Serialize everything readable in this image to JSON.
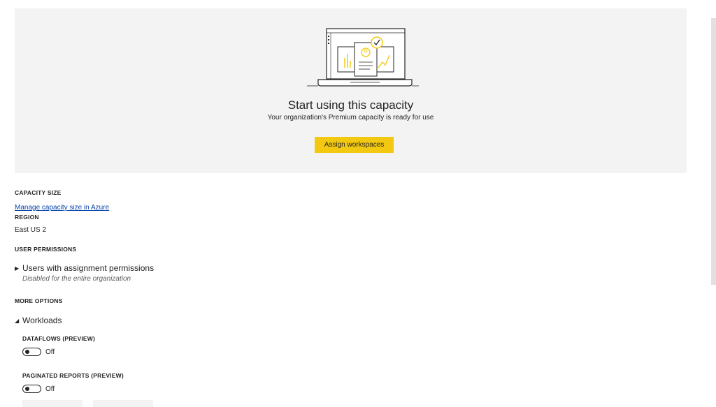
{
  "hero": {
    "title": "Start using this capacity",
    "subtitle": "Your organization's Premium capacity is ready for use",
    "assign_button": "Assign workspaces"
  },
  "capacity_size": {
    "heading": "CAPACITY SIZE",
    "link": "Manage capacity size in Azure"
  },
  "region": {
    "heading": "REGION",
    "value": "East US 2"
  },
  "user_permissions": {
    "heading": "USER PERMISSIONS",
    "item_label": "Users with assignment permissions",
    "item_sub": "Disabled for the entire organization"
  },
  "more_options": {
    "heading": "MORE OPTIONS",
    "workloads_label": "Workloads",
    "dataflows": {
      "heading": "DATAFLOWS (PREVIEW)",
      "state": "Off"
    },
    "paginated_reports": {
      "heading": "PAGINATED REPORTS (PREVIEW)",
      "state": "Off"
    }
  },
  "colors": {
    "accent": "#f2c811",
    "hero_bg": "#f3f3f3",
    "link": "#0645ad"
  },
  "icons": {
    "illustration": "laptop-reports-illustration",
    "collapsed": "caret-right-icon",
    "expanded": "caret-down-icon"
  }
}
